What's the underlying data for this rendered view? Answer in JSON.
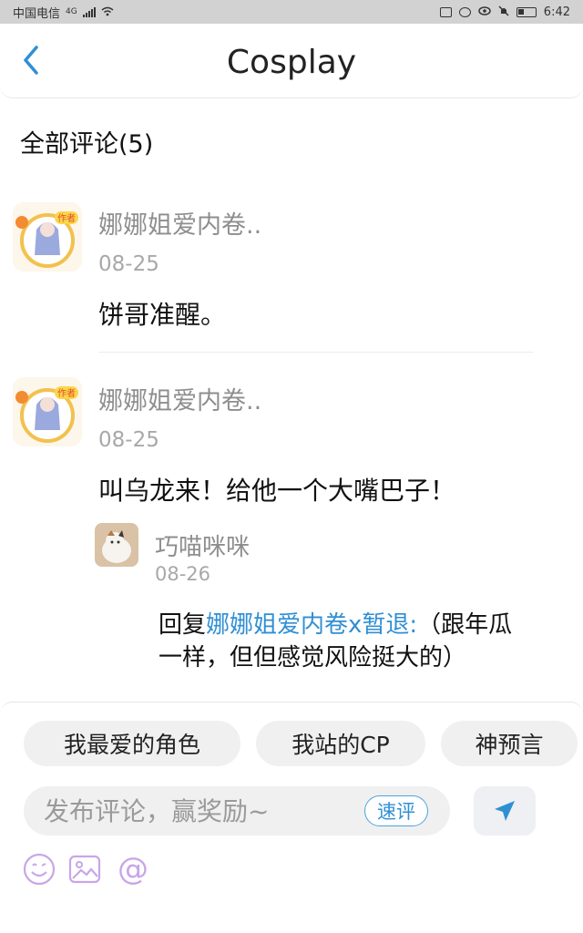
{
  "status_bar": {
    "carrier": "中国电信",
    "network": "4G",
    "time": "6:42"
  },
  "header": {
    "title": "Cosplay"
  },
  "section": {
    "title": "全部评论(5)"
  },
  "comments": [
    {
      "name": "娜娜姐爱内卷..",
      "date": "08-25",
      "text": "饼哥准醒。",
      "badge": "作者"
    },
    {
      "name": "娜娜姐爱内卷..",
      "date": "08-25",
      "text": "叫乌龙来！给他一个大嘴巴子！",
      "badge": "作者",
      "reply": {
        "name": "巧喵咪咪",
        "date": "08-26",
        "prefix": "回复",
        "target": "娜娜姐爱内卷x暂退:",
        "line1_rest": "（跟年瓜",
        "line2": "一样，但但感觉风险挺大的）"
      }
    }
  ],
  "quick_tags": [
    "我最爱的角色",
    "我站的CP",
    "神预言"
  ],
  "composer": {
    "placeholder": "发布评论，赢奖励~",
    "quick_label": "速评"
  },
  "colors": {
    "accent": "#2f8fd4",
    "toolbar_icon": "#c9a6e8"
  },
  "icons": [
    "back-chevron-icon",
    "send-icon",
    "emoji-icon",
    "image-icon",
    "at-icon"
  ]
}
